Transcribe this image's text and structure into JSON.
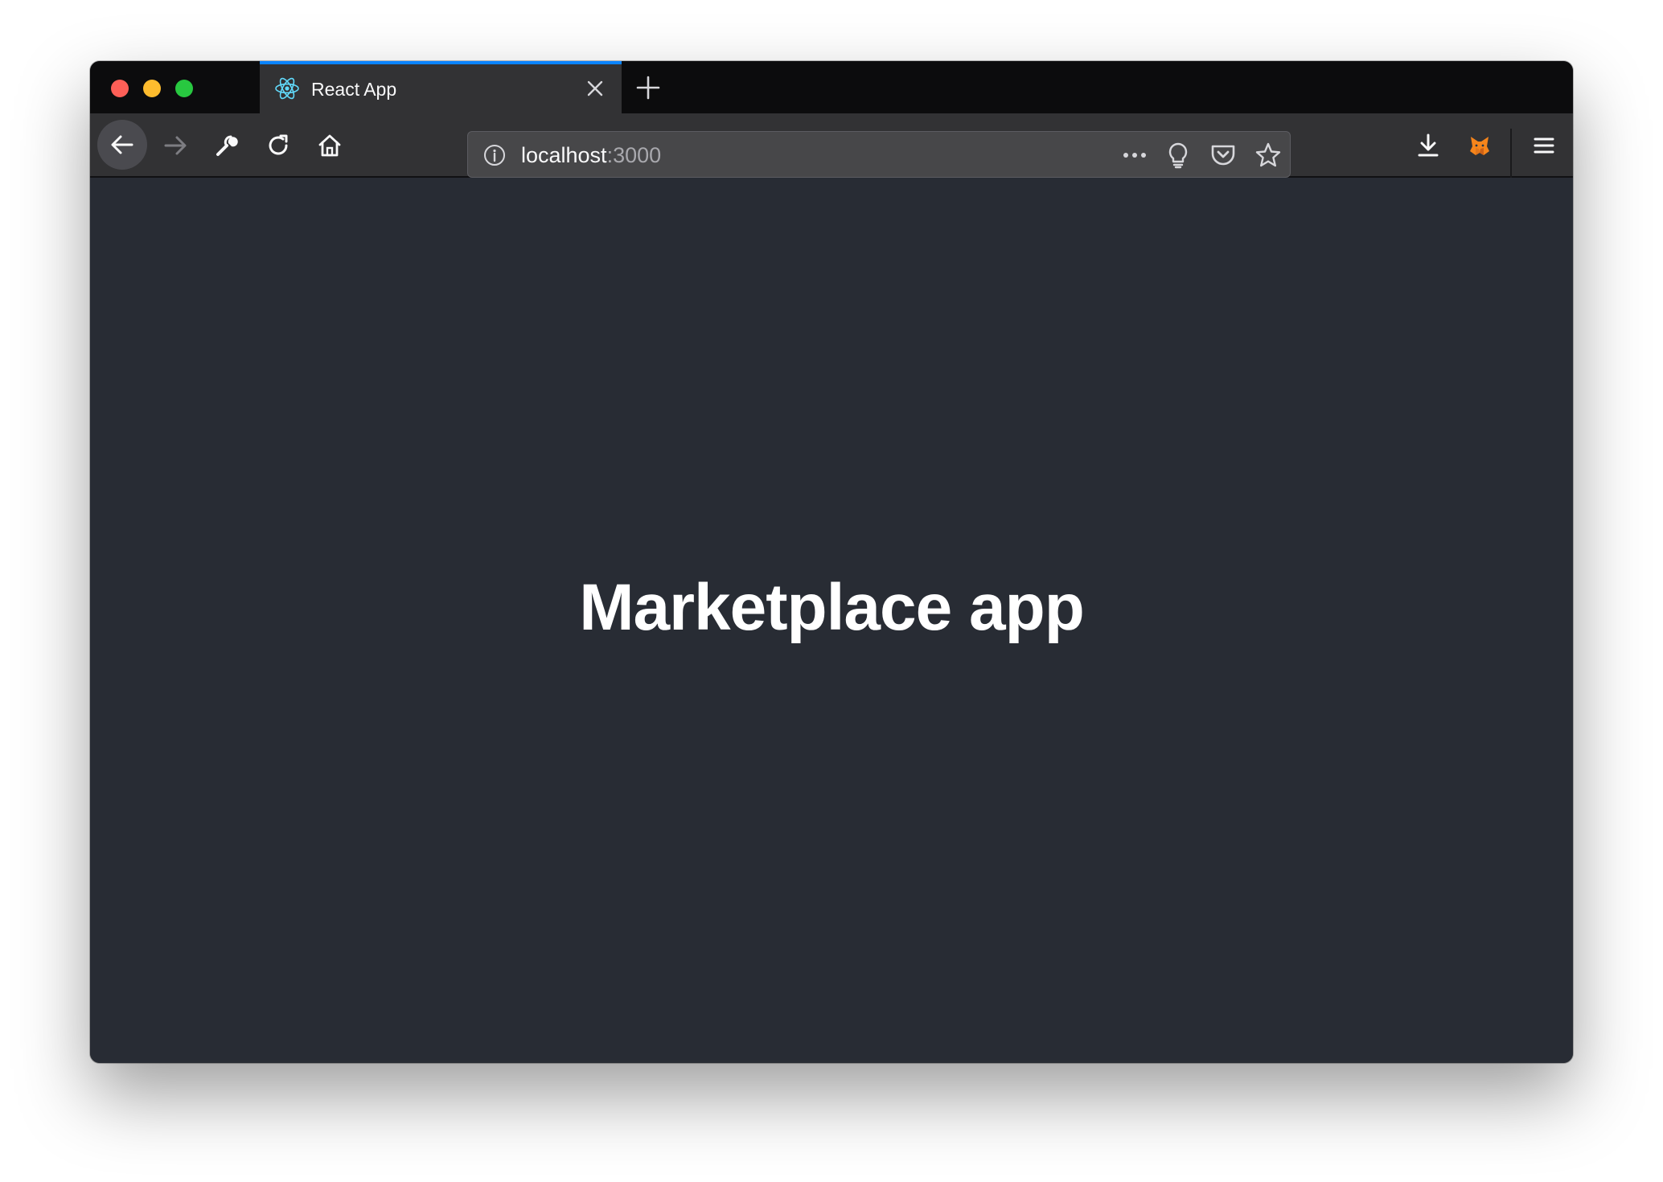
{
  "browser": {
    "tab": {
      "title": "React App",
      "favicon": "react-logo-icon"
    },
    "toolbar": {
      "back": "back-arrow-icon",
      "forward": "forward-arrow-icon",
      "devtools": "wrench-icon",
      "reload": "reload-icon",
      "home": "home-icon",
      "downloads": "download-icon",
      "extension": "metamask-fox-icon",
      "menu": "hamburger-menu-icon"
    },
    "url": {
      "host": "localhost",
      "port": ":3000",
      "info": "info-icon",
      "page_actions": "more-dots-icon",
      "insights": "lightbulb-icon",
      "pocket": "pocket-icon",
      "bookmark": "star-icon"
    },
    "colors": {
      "tab_accent": "#0a84ff",
      "page_background": "#282c34",
      "react_blue": "#61dafb",
      "metamask_orange": "#f6851b"
    }
  },
  "page": {
    "heading": "Marketplace app"
  }
}
